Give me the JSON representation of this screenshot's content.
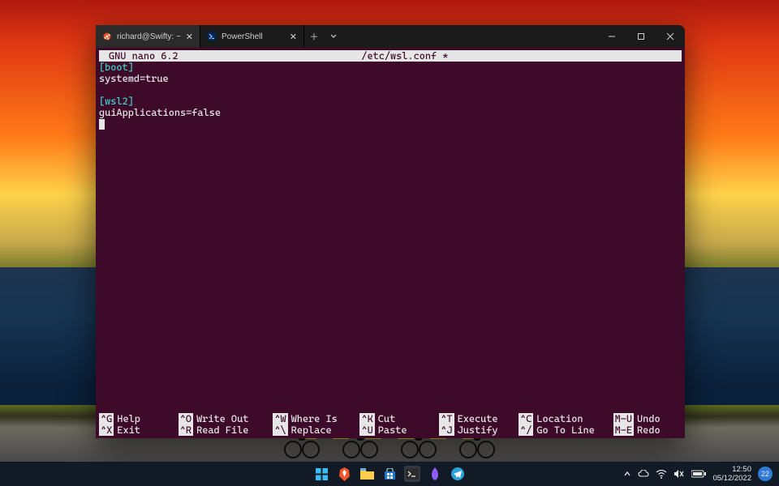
{
  "titlebar": {
    "tabs": [
      {
        "icon_bg": "#e95420",
        "label": "richard@Swifty: ~",
        "active": true
      },
      {
        "icon_bg": "#012456",
        "label": "PowerShell",
        "active": false
      }
    ]
  },
  "nano": {
    "app_title": "GNU nano 6.2",
    "filename": "/etc/wsl.conf *",
    "content": {
      "section1": "[boot]",
      "line1": "systemd=true",
      "section2": "[wsl2]",
      "line2": "guiApplications=false"
    },
    "shortcuts": [
      {
        "key": "^G",
        "label": "Help"
      },
      {
        "key": "^O",
        "label": "Write Out"
      },
      {
        "key": "^W",
        "label": "Where Is"
      },
      {
        "key": "^K",
        "label": "Cut"
      },
      {
        "key": "^T",
        "label": "Execute"
      },
      {
        "key": "^C",
        "label": "Location"
      },
      {
        "key": "M-U",
        "label": "Undo"
      },
      {
        "key": "^X",
        "label": "Exit"
      },
      {
        "key": "^R",
        "label": "Read File"
      },
      {
        "key": "^\\",
        "label": "Replace"
      },
      {
        "key": "^U",
        "label": "Paste"
      },
      {
        "key": "^J",
        "label": "Justify"
      },
      {
        "key": "^/",
        "label": "Go To Line"
      },
      {
        "key": "M-E",
        "label": "Redo"
      }
    ]
  },
  "taskbar": {
    "time": "12:50",
    "date": "05/12/2022",
    "notif_count": "22"
  }
}
